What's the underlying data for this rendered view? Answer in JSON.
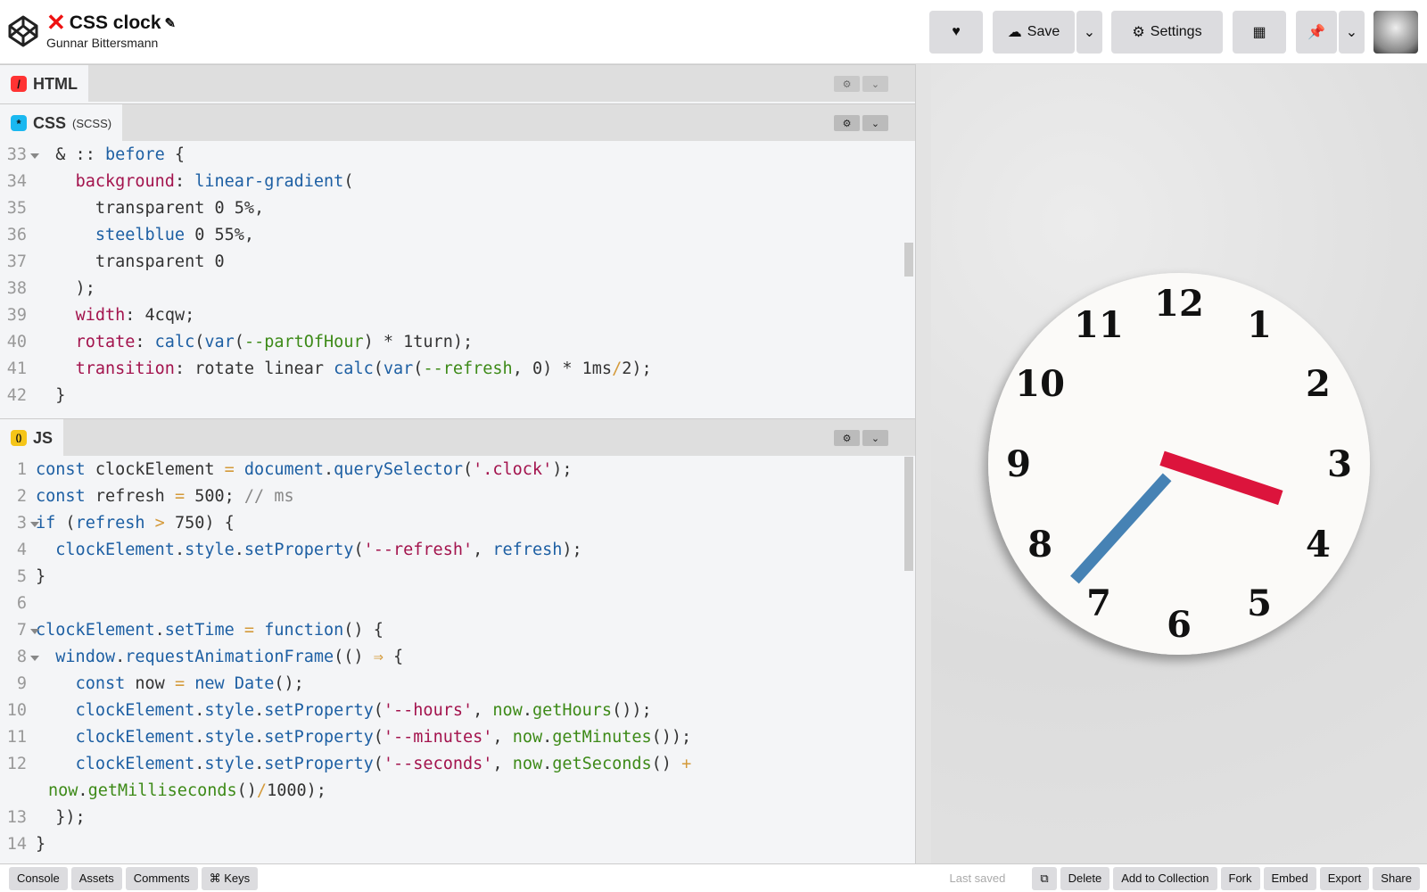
{
  "header": {
    "title": "CSS clock",
    "author": "Gunnar Bittersmann",
    "buttons": {
      "save": "Save",
      "settings": "Settings"
    }
  },
  "panes": {
    "html": {
      "label": "HTML",
      "icon": "/"
    },
    "css": {
      "label": "CSS",
      "sub": "(SCSS)",
      "icon": "*"
    },
    "js": {
      "label": "JS",
      "icon": "()"
    }
  },
  "css_code": [
    {
      "n": "33",
      "fold": true,
      "t": [
        [
          "",
          "  & :: "
        ],
        [
          "kw",
          "before"
        ],
        [
          "",
          " {"
        ]
      ]
    },
    {
      "n": "34",
      "t": [
        [
          "",
          "    "
        ],
        [
          "pr",
          "background"
        ],
        [
          "",
          ": "
        ],
        [
          "fn",
          "linear-gradient"
        ],
        [
          "",
          "("
        ]
      ]
    },
    {
      "n": "35",
      "t": [
        [
          "",
          "      transparent 0 5%,"
        ]
      ]
    },
    {
      "n": "36",
      "t": [
        [
          "",
          "      "
        ],
        [
          "kw",
          "steelblue"
        ],
        [
          "",
          " 0 55%,"
        ]
      ]
    },
    {
      "n": "37",
      "t": [
        [
          "",
          "      transparent 0"
        ]
      ]
    },
    {
      "n": "38",
      "t": [
        [
          "",
          "    );"
        ]
      ]
    },
    {
      "n": "39",
      "t": [
        [
          "",
          "    "
        ],
        [
          "pr",
          "width"
        ],
        [
          "",
          ": 4cqw;"
        ]
      ]
    },
    {
      "n": "40",
      "t": [
        [
          "",
          "    "
        ],
        [
          "pr",
          "rotate"
        ],
        [
          "",
          ": "
        ],
        [
          "fn",
          "calc"
        ],
        [
          "",
          "("
        ],
        [
          "fn",
          "var"
        ],
        [
          "",
          "("
        ],
        [
          "gr",
          "--partOfHour"
        ],
        [
          "",
          ") * 1turn);"
        ]
      ]
    },
    {
      "n": "41",
      "t": [
        [
          "",
          "    "
        ],
        [
          "pr",
          "transition"
        ],
        [
          "",
          ": rotate linear "
        ],
        [
          "fn",
          "calc"
        ],
        [
          "",
          "("
        ],
        [
          "fn",
          "var"
        ],
        [
          "",
          "("
        ],
        [
          "gr",
          "--refresh"
        ],
        [
          "",
          ", 0) * 1ms"
        ],
        [
          "op",
          "/"
        ],
        [
          "",
          "2);"
        ]
      ]
    },
    {
      "n": "42",
      "t": [
        [
          "",
          "  }"
        ]
      ]
    }
  ],
  "js_code": [
    {
      "n": "1",
      "t": [
        [
          "kw",
          "const"
        ],
        [
          "",
          " clockElement "
        ],
        [
          "op",
          "="
        ],
        [
          "",
          " "
        ],
        [
          "kw",
          "document"
        ],
        [
          "",
          "."
        ],
        [
          "fn",
          "querySelector"
        ],
        [
          "",
          "("
        ],
        [
          "st",
          "'.clock'"
        ],
        [
          "",
          ");"
        ]
      ]
    },
    {
      "n": "2",
      "t": [
        [
          "kw",
          "const"
        ],
        [
          "",
          " refresh "
        ],
        [
          "op",
          "="
        ],
        [
          "",
          " 500; "
        ],
        [
          "cm",
          "// ms"
        ]
      ]
    },
    {
      "n": "3",
      "fold": true,
      "t": [
        [
          "kw",
          "if"
        ],
        [
          "",
          " ("
        ],
        [
          "kw",
          "refresh"
        ],
        [
          "",
          " "
        ],
        [
          "op",
          ">"
        ],
        [
          "",
          " 750) {"
        ]
      ]
    },
    {
      "n": "4",
      "t": [
        [
          "",
          "  "
        ],
        [
          "kw",
          "clockElement"
        ],
        [
          "",
          "."
        ],
        [
          "kw",
          "style"
        ],
        [
          "",
          "."
        ],
        [
          "fn",
          "setProperty"
        ],
        [
          "",
          "("
        ],
        [
          "st",
          "'--refresh'"
        ],
        [
          "",
          ", "
        ],
        [
          "kw",
          "refresh"
        ],
        [
          "",
          ");"
        ]
      ]
    },
    {
      "n": "5",
      "t": [
        [
          "",
          "}"
        ]
      ]
    },
    {
      "n": "6",
      "t": [
        [
          "",
          ""
        ]
      ]
    },
    {
      "n": "7",
      "fold": true,
      "t": [
        [
          "kw",
          "clockElement"
        ],
        [
          "",
          "."
        ],
        [
          "fn",
          "setTime"
        ],
        [
          "",
          " "
        ],
        [
          "op",
          "="
        ],
        [
          "",
          " "
        ],
        [
          "kw",
          "function"
        ],
        [
          "",
          "() {"
        ]
      ]
    },
    {
      "n": "8",
      "fold": true,
      "t": [
        [
          "",
          "  "
        ],
        [
          "kw",
          "window"
        ],
        [
          "",
          "."
        ],
        [
          "fn",
          "requestAnimationFrame"
        ],
        [
          "",
          "(() "
        ],
        [
          "op",
          "⇒"
        ],
        [
          "",
          " {"
        ]
      ]
    },
    {
      "n": "9",
      "t": [
        [
          "",
          "    "
        ],
        [
          "kw",
          "const"
        ],
        [
          "",
          " now "
        ],
        [
          "op",
          "="
        ],
        [
          "",
          " "
        ],
        [
          "kw",
          "new"
        ],
        [
          "",
          " "
        ],
        [
          "kw",
          "Date"
        ],
        [
          "",
          "();"
        ]
      ]
    },
    {
      "n": "10",
      "t": [
        [
          "",
          "    "
        ],
        [
          "kw",
          "clockElement"
        ],
        [
          "",
          "."
        ],
        [
          "kw",
          "style"
        ],
        [
          "",
          "."
        ],
        [
          "fn",
          "setProperty"
        ],
        [
          "",
          "("
        ],
        [
          "st",
          "'--hours'"
        ],
        [
          "",
          ", "
        ],
        [
          "gr",
          "now"
        ],
        [
          "",
          "."
        ],
        [
          "gr",
          "getHours"
        ],
        [
          "",
          "());"
        ]
      ]
    },
    {
      "n": "11",
      "t": [
        [
          "",
          "    "
        ],
        [
          "kw",
          "clockElement"
        ],
        [
          "",
          "."
        ],
        [
          "kw",
          "style"
        ],
        [
          "",
          "."
        ],
        [
          "fn",
          "setProperty"
        ],
        [
          "",
          "("
        ],
        [
          "st",
          "'--minutes'"
        ],
        [
          "",
          ", "
        ],
        [
          "gr",
          "now"
        ],
        [
          "",
          "."
        ],
        [
          "gr",
          "getMinutes"
        ],
        [
          "",
          "());"
        ]
      ]
    },
    {
      "n": "12",
      "t": [
        [
          "",
          "    "
        ],
        [
          "kw",
          "clockElement"
        ],
        [
          "",
          "."
        ],
        [
          "kw",
          "style"
        ],
        [
          "",
          "."
        ],
        [
          "fn",
          "setProperty"
        ],
        [
          "",
          "("
        ],
        [
          "st",
          "'--seconds'"
        ],
        [
          "",
          ", "
        ],
        [
          "gr",
          "now"
        ],
        [
          "",
          "."
        ],
        [
          "gr",
          "getSeconds"
        ],
        [
          "",
          "() "
        ],
        [
          "op",
          "+"
        ]
      ]
    },
    {
      "n": "",
      "t": [
        [
          "gr",
          "now"
        ],
        [
          "",
          "."
        ],
        [
          "gr",
          "getMilliseconds"
        ],
        [
          "",
          "()"
        ],
        [
          "op",
          "/"
        ],
        [
          "",
          "1000);"
        ]
      ]
    },
    {
      "n": "13",
      "t": [
        [
          "",
          "  });"
        ]
      ]
    },
    {
      "n": "14",
      "t": [
        [
          "",
          "}"
        ]
      ]
    }
  ],
  "clock": {
    "numerals": [
      "12",
      "1",
      "2",
      "3",
      "4",
      "5",
      "6",
      "7",
      "8",
      "9",
      "10",
      "11"
    ],
    "hours": 3,
    "minutes": 37,
    "hour_hand_color": "#dc143c",
    "minute_hand_color": "#4682b4"
  },
  "footer": {
    "left": [
      "Console",
      "Assets",
      "Comments",
      "⌘ Keys"
    ],
    "last_saved": "Last saved",
    "right": [
      "Delete",
      "Add to Collection",
      "Fork",
      "Embed",
      "Export",
      "Share"
    ]
  }
}
